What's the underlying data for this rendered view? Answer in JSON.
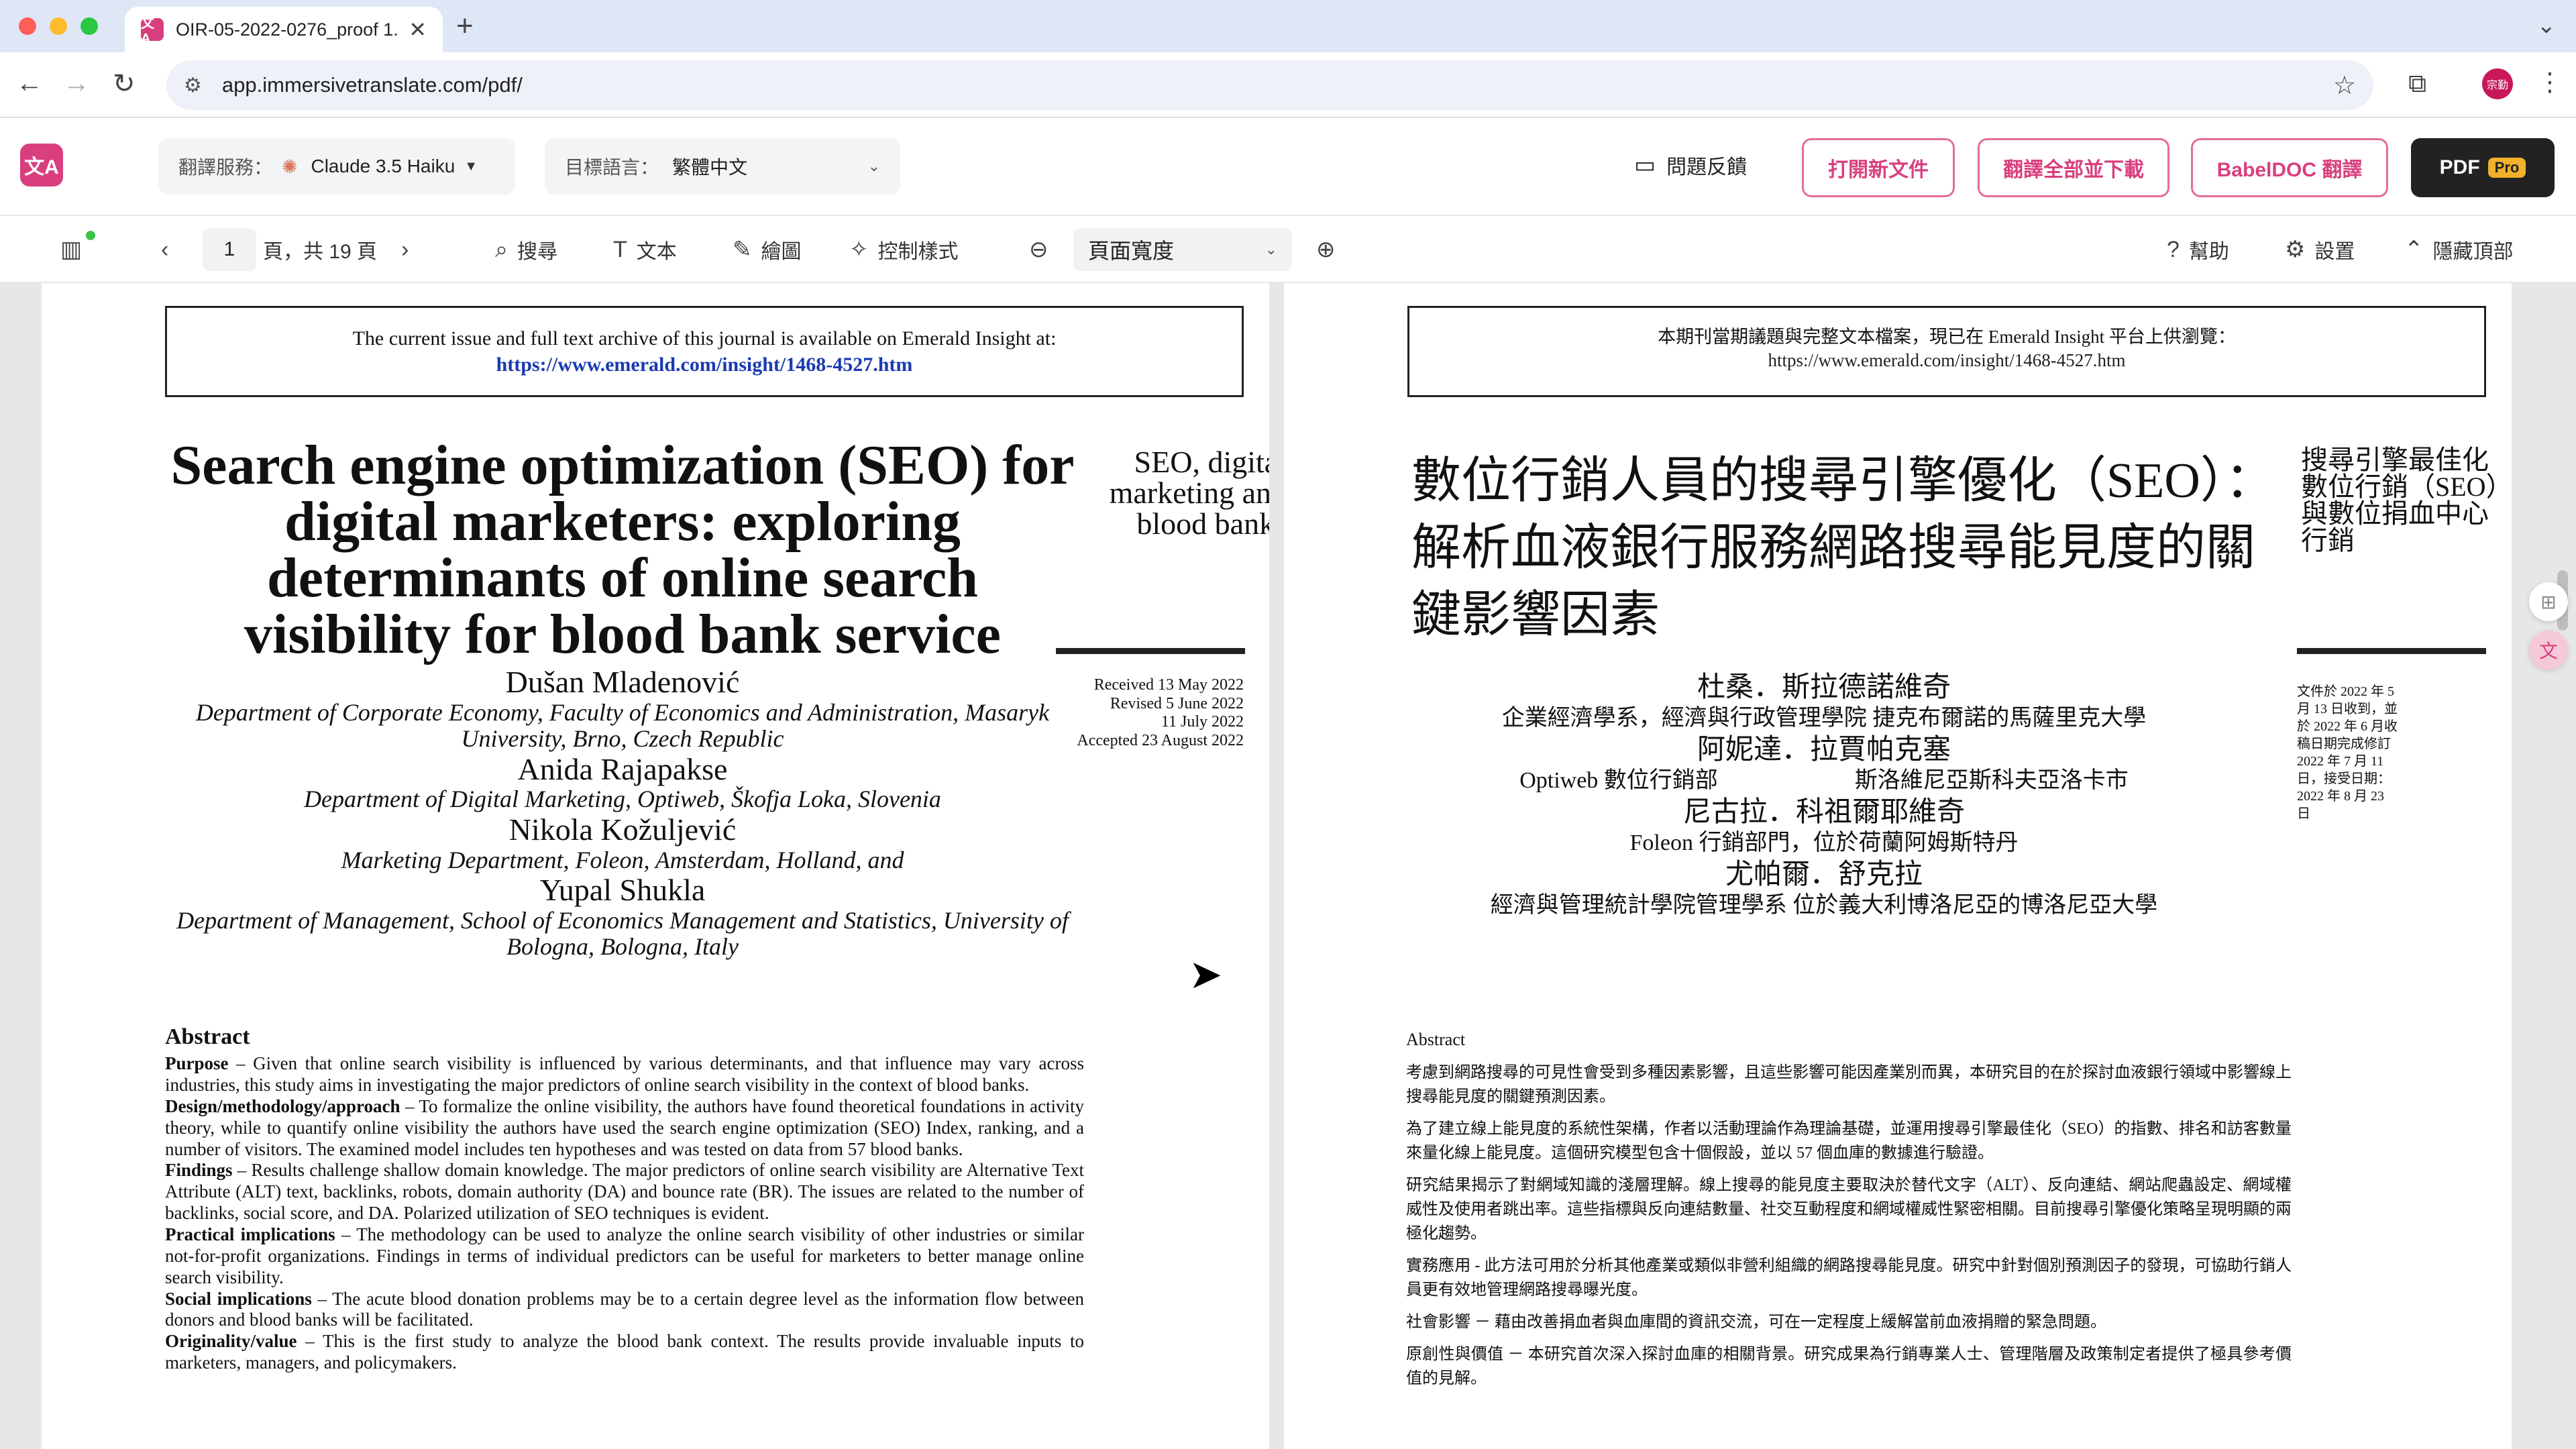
{
  "browser": {
    "tab_favicon": "文A",
    "tab_title": "OIR-05-2022-0276_proof 1.",
    "new_tab": "+",
    "close": "✕",
    "url": "app.immersivetranslate.com/pdf/",
    "profile_label": "宗勤"
  },
  "app": {
    "logo": "文A",
    "service_label": "翻譯服務：",
    "service_value": "Claude 3.5 Haiku",
    "target_label": "目標語言：",
    "target_value": "繁體中文",
    "feedback": "問題反饋",
    "open_new": "打開新文件",
    "translate_all": "翻譯全部並下載",
    "babeldoc": "BabelDOC 翻譯",
    "pdf": "PDF",
    "pro": "Pro"
  },
  "viewer": {
    "page_current": "1",
    "page_total_text": "頁，共 19 頁",
    "search": "搜尋",
    "text": "文本",
    "draw": "繪圖",
    "control_style": "控制樣式",
    "zoom_value": "頁面寬度",
    "help": "幫助",
    "settings": "設置",
    "hide_top": "隱藏頂部"
  },
  "original": {
    "notice_line1": "The current issue and full text archive of this journal is available on Emerald Insight at:",
    "notice_link": "https://www.emerald.com/insight/1468-4527.htm",
    "title": "Search engine optimization (SEO) for digital marketers: exploring determinants of online search visibility for blood bank service",
    "running_head": "SEO, digital marketing and blood banks",
    "dates": [
      "Received 13 May 2022",
      "Revised 5 June 2022",
      "11 July 2022",
      "Accepted 23 August 2022"
    ],
    "authors": [
      {
        "name": "Dušan Mladenović",
        "aff": "Department of Corporate Economy, Faculty of Economics and Administration, Masaryk University, Brno, Czech Republic"
      },
      {
        "name": "Anida Rajapakse",
        "aff": "Department of Digital Marketing, Optiweb, Škofja Loka, Slovenia"
      },
      {
        "name": "Nikola Kožuljević",
        "aff": "Marketing Department, Foleon, Amsterdam, Holland, and"
      },
      {
        "name": "Yupal Shukla",
        "aff": "Department of Management, School of Economics Management and Statistics, University of Bologna, Bologna, Italy"
      }
    ],
    "abstract_heading": "Abstract",
    "abstract": [
      {
        "label": "Purpose",
        "text": " – Given that online search visibility is influenced by various determinants, and that influence may vary across industries, this study aims in investigating the major predictors of online search visibility in the context of blood banks."
      },
      {
        "label": "Design/methodology/approach",
        "text": " – To formalize the online visibility, the authors have found theoretical foundations in activity theory, while to quantify online visibility the authors have used the search engine optimization (SEO) Index, ranking, and a number of visitors. The examined model includes ten hypotheses and was tested on data from 57 blood banks."
      },
      {
        "label": "Findings",
        "text": " – Results challenge shallow domain knowledge. The major predictors of online search visibility are Alternative Text Attribute (ALT) text, backlinks, robots, domain authority (DA) and bounce rate (BR). The issues are related to the number of backlinks, social score, and DA. Polarized utilization of SEO techniques is evident."
      },
      {
        "label": "Practical implications",
        "text": " – The methodology can be used to analyze the online search visibility of other industries or similar not-for-profit organizations. Findings in terms of individual predictors can be useful for marketers to better manage online search visibility."
      },
      {
        "label": "Social implications",
        "text": " – The acute blood donation problems may be to a certain degree level as the information flow between donors and blood banks will be facilitated."
      },
      {
        "label": "Originality/value",
        "text": " – This is the first study to analyze the blood bank context. The results provide invaluable inputs to marketers, managers, and policymakers."
      }
    ]
  },
  "translated": {
    "notice_line1": "本期刊當期議題與完整文本檔案，現已在 Emerald Insight 平台上供瀏覽：",
    "notice_link": "https://www.emerald.com/insight/1468-4527.htm",
    "title": "數位行銷人員的搜尋引擎優化（SEO）：解析血液銀行服務網路搜尋能見度的關鍵影響因素",
    "running_head": "搜尋引擎最佳化數位行銷（SEO）與數位捐血中心行銷",
    "dates": "文件於 2022 年 5 月 13 日收到，並於 2022 年 6 月收稿日期完成修訂 2022 年 7 月 11 日，接受日期：2022 年 8 月 23 日",
    "authors": [
      {
        "name": "杜桑．斯拉德諾維奇",
        "aff": "企業經濟學系，經濟與行政管理學院 捷克布爾諾的馬薩里克大學"
      },
      {
        "name": "阿妮達．拉賈帕克塞",
        "aff": "Optiweb 數位行銷部　　　　　　斯洛維尼亞斯科夫亞洛卡市"
      },
      {
        "name": "尼古拉．科祖爾耶維奇",
        "aff": "Foleon 行銷部門，位於荷蘭阿姆斯特丹"
      },
      {
        "name": "尤帕爾．舒克拉",
        "aff": "經濟與管理統計學院管理學系 位於義大利博洛尼亞的博洛尼亞大學"
      }
    ],
    "abstract_heading": "Abstract",
    "abstract": [
      "考慮到網路搜尋的可見性會受到多種因素影響，且這些影響可能因產業別而異，本研究目的在於探討血液銀行領域中影響線上搜尋能見度的關鍵預測因素。",
      "為了建立線上能見度的系統性架構，作者以活動理論作為理論基礎，並運用搜尋引擎最佳化（SEO）的指數、排名和訪客數量來量化線上能見度。這個研究模型包含十個假設，並以 57 個血庫的數據進行驗證。",
      "研究結果揭示了對網域知識的淺層理解。線上搜尋的能見度主要取決於替代文字（ALT）、反向連結、網站爬蟲設定、網域權威性及使用者跳出率。這些指標與反向連結數量、社交互動程度和網域權威性緊密相關。目前搜尋引擎優化策略呈現明顯的兩極化趨勢。",
      "實務應用 - 此方法可用於分析其他產業或類似非營利組織的網路搜尋能見度。研究中針對個別預測因子的發現，可協助行銷人員更有效地管理網路搜尋曝光度。",
      "社會影響 － 藉由改善捐血者與血庫間的資訊交流，可在一定程度上緩解當前血液捐贈的緊急問題。",
      "原創性與價值 － 本研究首次深入探討血庫的相關背景。研究成果為行銷專業人士、管理階層及政策制定者提供了極具參考價值的見解。"
    ]
  },
  "colors": {
    "accent": "#d93f7e",
    "tabbar": "#dfe6f5",
    "pro_badge": "#f2b12c"
  },
  "icons": [
    "back-arrow-icon",
    "forward-arrow-icon",
    "reload-icon",
    "site-info-icon",
    "star-icon",
    "extensions-icon",
    "feedback-icon",
    "search-icon",
    "text-icon",
    "draw-icon",
    "control-style-icon",
    "zoom-out-icon",
    "zoom-in-icon",
    "help-icon",
    "settings-icon",
    "hide-top-icon",
    "sidebar-toggle-icon"
  ]
}
